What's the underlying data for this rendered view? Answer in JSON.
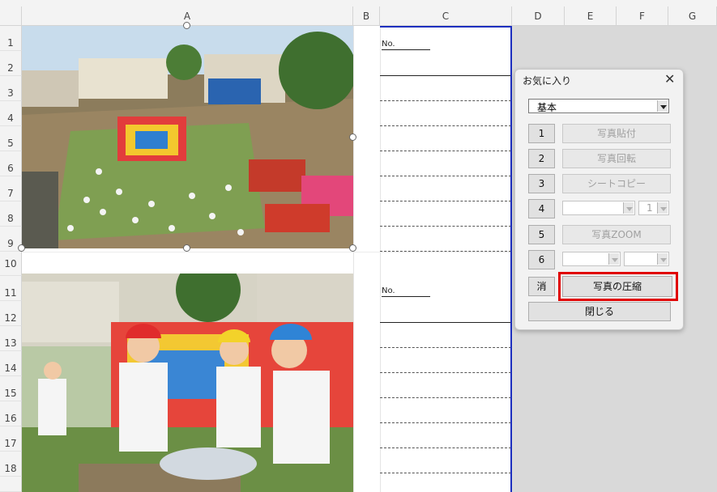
{
  "spreadsheet": {
    "columns": [
      "A",
      "B",
      "C",
      "D",
      "E",
      "F",
      "G"
    ],
    "rows": [
      "1",
      "2",
      "3",
      "4",
      "5",
      "6",
      "7",
      "8",
      "9",
      "10",
      "11",
      "12",
      "13",
      "14",
      "15",
      "16",
      "17",
      "18"
    ],
    "no_labels": [
      "No.",
      "No."
    ]
  },
  "images": {
    "photo1": "school festival crowd photo",
    "photo2": "children playing game photo"
  },
  "dialog": {
    "title": "お気に入り",
    "close_icon": "close-icon",
    "preset_select": "基本",
    "steps": [
      {
        "num": "1",
        "label": "写真貼付"
      },
      {
        "num": "2",
        "label": "写真回転"
      },
      {
        "num": "3",
        "label": "シートコピー"
      },
      {
        "num": "4",
        "select_a": "",
        "select_b": "1"
      },
      {
        "num": "5",
        "label": "写真ZOOM"
      },
      {
        "num": "6",
        "select_a": "",
        "select_b": ""
      }
    ],
    "clear_label": "消",
    "compress_label": "写真の圧縮",
    "close_label": "閉じる"
  },
  "colors": {
    "highlight": "#e00000",
    "print_border": "#1d2fbf"
  }
}
